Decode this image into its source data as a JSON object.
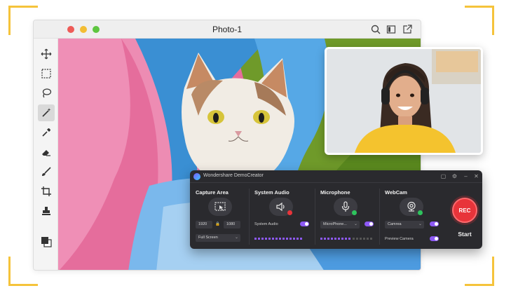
{
  "window": {
    "title": "Photo-1",
    "toolbar_icons": [
      "move-icon",
      "marquee-select-icon",
      "lasso-icon",
      "magic-wand-icon",
      "eyedropper-icon",
      "eraser-icon",
      "brush-icon",
      "crop-icon",
      "stamp-icon",
      "color-swatch-icon"
    ],
    "active_tool": "magic-wand-icon",
    "titlebar_icons": [
      "search-icon",
      "sidebar-icon",
      "share-icon"
    ]
  },
  "recorder": {
    "app_name": "Wondershare DemoCreator",
    "capture_area": {
      "title": "Capture Area",
      "width": "1920",
      "height": "1080",
      "mode": "Full Screen"
    },
    "system_audio": {
      "title": "System Audio",
      "label": "System Audio",
      "enabled": true,
      "status": "error"
    },
    "microphone": {
      "title": "Microphone",
      "device": "MicroPhone...",
      "enabled": true,
      "status": "ok"
    },
    "webcam": {
      "title": "WebCam",
      "device": "Camrea",
      "preview_label": "Preview Camera",
      "preview_enabled": true,
      "enabled": true,
      "status": "ok"
    },
    "rec_label": "REC",
    "start_label": "Start"
  },
  "colors": {
    "accent": "#8d59f5",
    "rec_red": "#e8343a",
    "ok_green": "#2ec35d",
    "error_red": "#e8343a",
    "corner_yellow": "#f5c33b"
  }
}
